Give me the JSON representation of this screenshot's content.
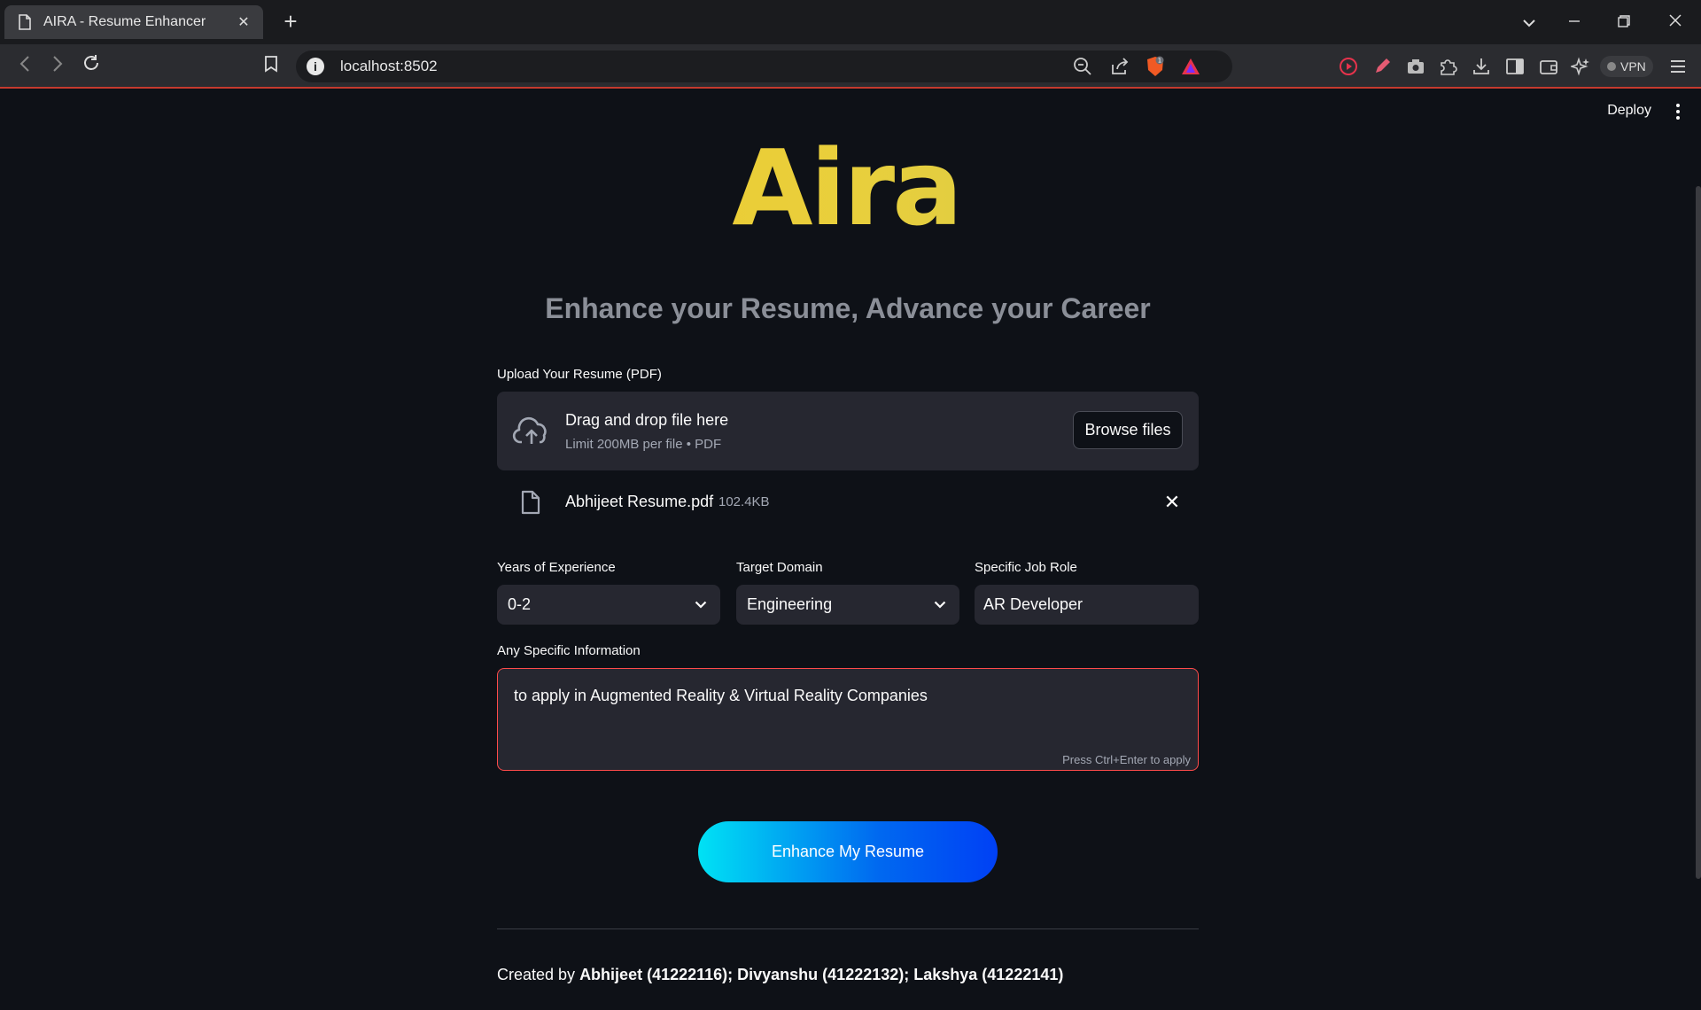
{
  "browser": {
    "tab_title": "AIRA - Resume Enhancer",
    "url": "localhost:8502",
    "vpn_label": "VPN"
  },
  "header": {
    "deploy_label": "Deploy"
  },
  "app": {
    "logo_text": "Aira",
    "logo_colors": [
      "#f6c216",
      "#b9c95c"
    ],
    "tagline": "Enhance your Resume, Advance your Career"
  },
  "upload": {
    "label": "Upload Your Resume (PDF)",
    "drop_title": "Drag and drop file here",
    "limit_text": "Limit 200MB per file • PDF",
    "browse_label": "Browse files",
    "file_name": "Abhijeet Resume.pdf",
    "file_size": "102.4KB"
  },
  "form": {
    "experience_label": "Years of Experience",
    "experience_value": "0-2",
    "domain_label": "Target Domain",
    "domain_value": "Engineering",
    "role_label": "Specific Job Role",
    "role_value": "AR Developer",
    "info_label": "Any Specific Information",
    "info_value": "to apply in Augmented Reality & Virtual Reality Companies",
    "info_hint": "Press Ctrl+Enter to apply"
  },
  "actions": {
    "enhance_label": "Enhance My Resume",
    "button_gradient": [
      "#00e2f4",
      "#0040f5"
    ]
  },
  "footer": {
    "prefix": "Created by ",
    "authors": "Abhijeet (41222116); Divyanshu (41222132); Lakshya (41222141)"
  }
}
